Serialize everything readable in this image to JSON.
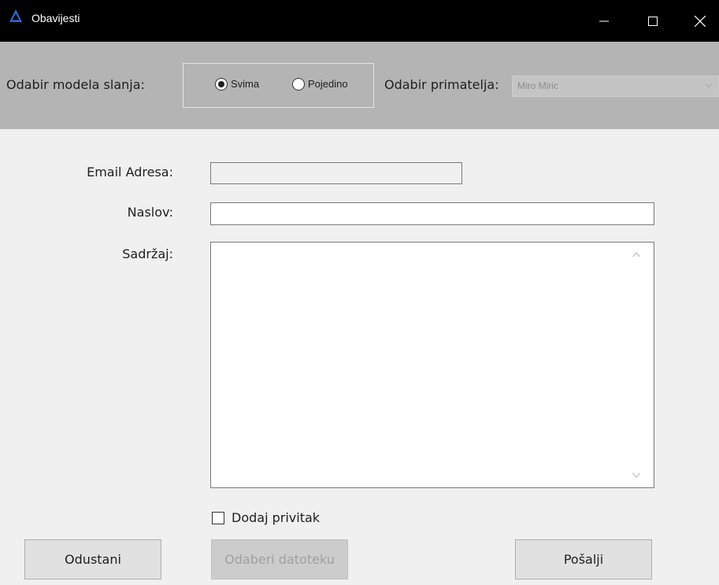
{
  "window": {
    "title": "Obavijesti",
    "controls": [
      "minimize-icon",
      "maximize-icon",
      "close-icon"
    ]
  },
  "header": {
    "send_model_label": "Odabir modela slanja:",
    "options": [
      {
        "label": "Svima",
        "selected": true
      },
      {
        "label": "Pojedino",
        "selected": false
      }
    ],
    "recipient_label": "Odabir primatelja:",
    "recipient_value": "Miro Miric",
    "recipient_enabled": false
  },
  "form": {
    "email_label": "Email Adresa:",
    "email_value": "",
    "subject_label": "Naslov:",
    "subject_value": "",
    "content_label": "Sadržaj:",
    "content_value": "",
    "attach_label": "Dodaj privitak",
    "attach_checked": false
  },
  "buttons": {
    "cancel": "Odustani",
    "choose_file": "Odaberi datoteku",
    "send": "Pošalji"
  },
  "colors": {
    "titlebar": "#000000",
    "header": "#b4b4b4",
    "app_icon": "#2b6cd6"
  }
}
